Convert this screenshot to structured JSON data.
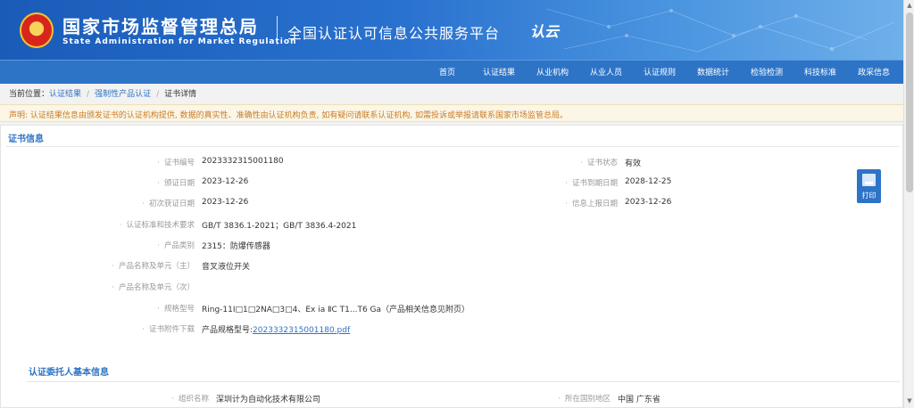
{
  "header": {
    "agency_cn": "国家市场监督管理总局",
    "agency_en": "State Administration for Market Regulation",
    "platform": "全国认证认可信息公共服务平台",
    "platform_logo": "认云"
  },
  "nav": {
    "items": [
      "首页",
      "认证结果",
      "从业机构",
      "从业人员",
      "认证规则",
      "数据统计",
      "检验检测",
      "科技标准",
      "政采信息"
    ]
  },
  "breadcrumb": {
    "prefix": "当前位置：",
    "items": [
      "认证结果",
      "强制性产品认证",
      "证书详情"
    ],
    "separator": "/"
  },
  "notice": "声明: 认证结果信息由颁发证书的认证机构提供, 数据的真实性、准确性由认证机构负责, 如有疑问请联系认证机构, 如需投诉或举报请联系国家市场监管总局。",
  "cert_section": {
    "title": "证书信息",
    "left_fields": [
      {
        "label": "证书编号",
        "value": "2023332315001180"
      },
      {
        "label": "颁证日期",
        "value": "2023-12-26"
      },
      {
        "label": "初次获证日期",
        "value": "2023-12-26"
      },
      {
        "label": "认证标准和技术要求",
        "value": "GB/T 3836.1-2021；GB/T 3836.4-2021"
      },
      {
        "label": "产品类别",
        "value": "2315：防爆传感器"
      },
      {
        "label": "产品名称及单元（主）",
        "value": "音叉液位开关"
      },
      {
        "label": "产品名称及单元（次）",
        "value": ""
      },
      {
        "label": "规格型号",
        "value": "Ring-11I□1□2NA□3□4、Ex ia ⅡC T1...T6 Ga（产品相关信息见附页）"
      }
    ],
    "attachment": {
      "label": "证书附件下载",
      "prefix": "产品规格型号:",
      "file": "2023332315001180.pdf"
    },
    "right_fields": [
      {
        "label": "证书状态",
        "value": "有效"
      },
      {
        "label": "证书到期日期",
        "value": "2028-12-25"
      },
      {
        "label": "信息上报日期",
        "value": "2023-12-26"
      }
    ],
    "print_label": "打印"
  },
  "client_section": {
    "title": "认证委托人基本信息",
    "fields": [
      {
        "label": "组织名称",
        "value": "深圳计为自动化技术有限公司"
      },
      {
        "label": "所在国别地区",
        "value": "中国 广东省"
      }
    ]
  },
  "colors": {
    "primary": "#2d74c7",
    "header_dark": "#1a5bb8",
    "notice_text": "#c97d2a",
    "label_gray": "#999999"
  }
}
